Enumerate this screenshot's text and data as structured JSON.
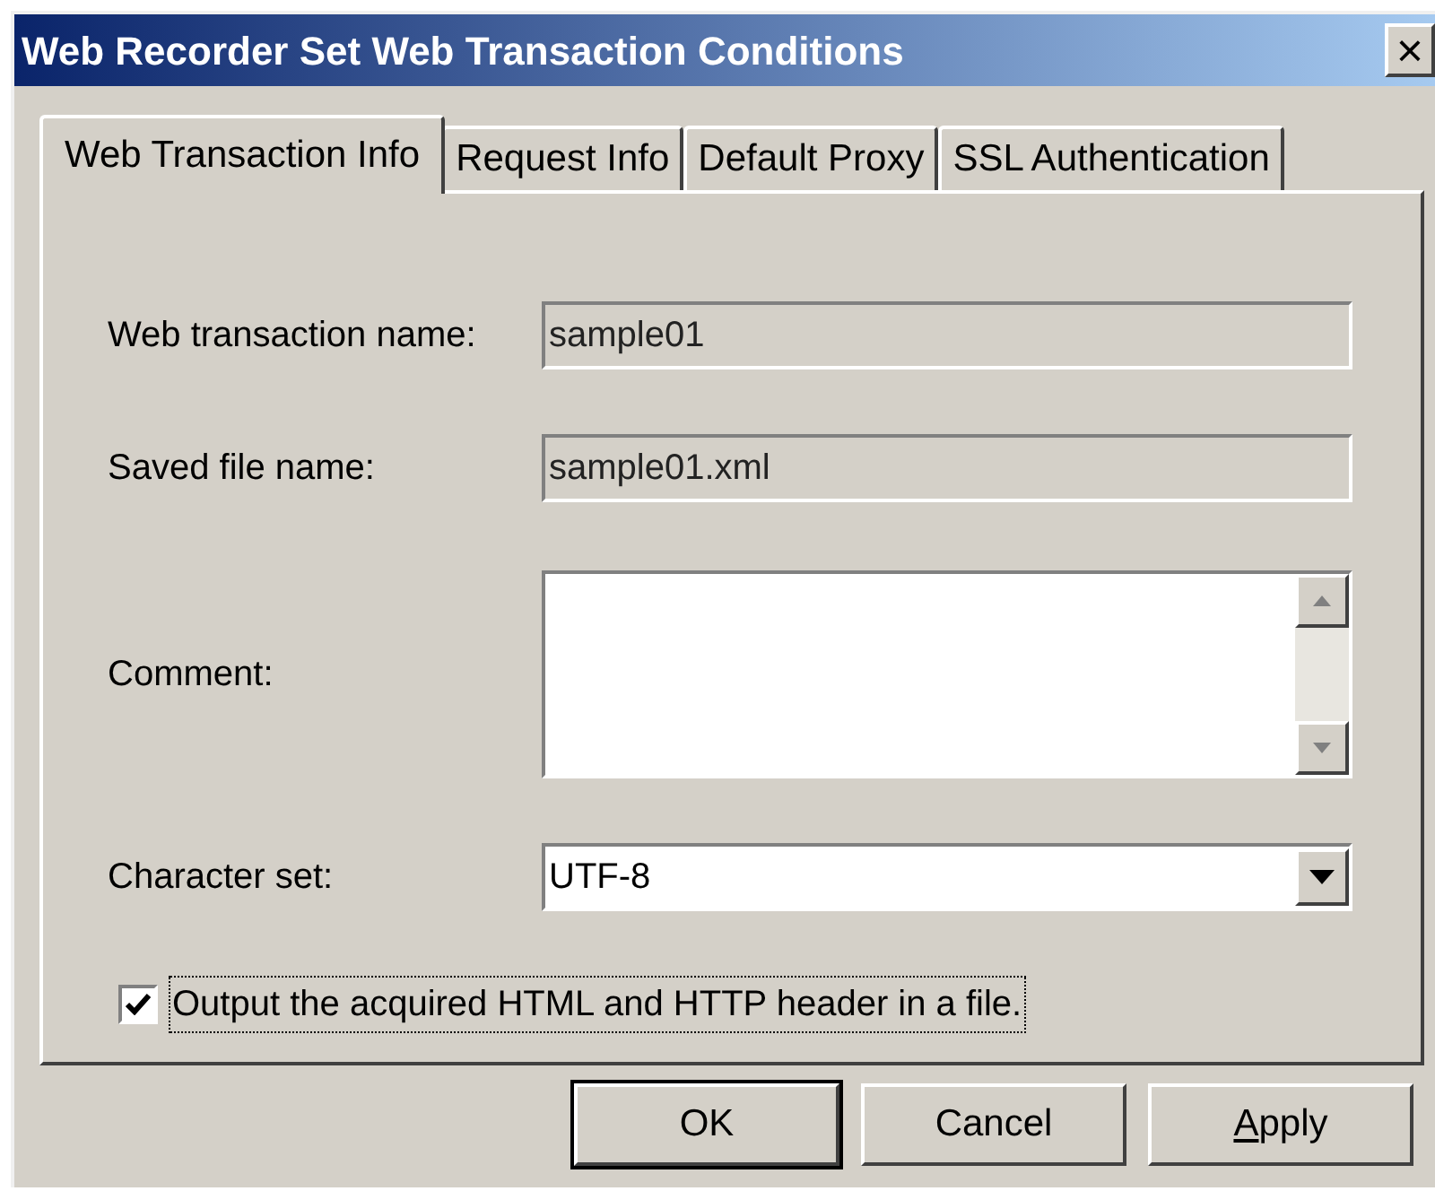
{
  "window": {
    "title": "Web Recorder Set Web Transaction Conditions",
    "close": "×"
  },
  "tabs": [
    {
      "label": "Web Transaction Info",
      "selected": true
    },
    {
      "label": "Request Info",
      "selected": false
    },
    {
      "label": "Default Proxy",
      "selected": false
    },
    {
      "label": "SSL Authentication",
      "selected": false
    }
  ],
  "fields": [
    {
      "kind": "text",
      "label": "Web transaction name:",
      "value": "sample01",
      "disabled": true
    },
    {
      "kind": "text",
      "label": "Saved file name:",
      "value": "sample01.xml",
      "disabled": true
    },
    {
      "kind": "textarea",
      "label": "Comment:",
      "disabled": false
    },
    {
      "kind": "select",
      "label": "Character set:",
      "value": "UTF-8",
      "disabled": false
    }
  ],
  "checkbox": {
    "label": "Output the acquired HTML and HTTP header in a file.",
    "checked": true
  },
  "buttons": [
    {
      "label": "OK",
      "default": true
    },
    {
      "label": "Cancel",
      "default": false
    },
    {
      "label": "Apply",
      "default": false,
      "first_letter_underlined": true
    }
  ]
}
